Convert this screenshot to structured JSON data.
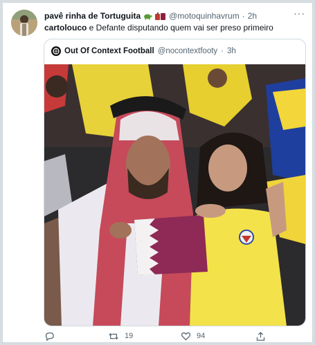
{
  "tweet": {
    "author_name": "pavê rinha de Tortuguita",
    "handle": "@motoquinhavrum",
    "separator": "·",
    "time": "2h",
    "text_mention": "cartolouco",
    "text_rest": " e Defante disputando quem vai ser preso primeiro",
    "more_label": "···"
  },
  "quoted": {
    "author_name": "Out Of Context Football",
    "handle": "@nocontextfooty",
    "separator": "·",
    "time": "3h"
  },
  "actions": {
    "reply_count": "",
    "retweet_count": "19",
    "like_count": "94"
  },
  "icons": {
    "reply": "reply-icon",
    "retweet": "retweet-icon",
    "like": "heart-icon",
    "share": "share-icon",
    "more": "more-icon"
  },
  "colors": {
    "text_primary": "#0f1419",
    "text_secondary": "#536471",
    "border": "#cfd9de"
  }
}
